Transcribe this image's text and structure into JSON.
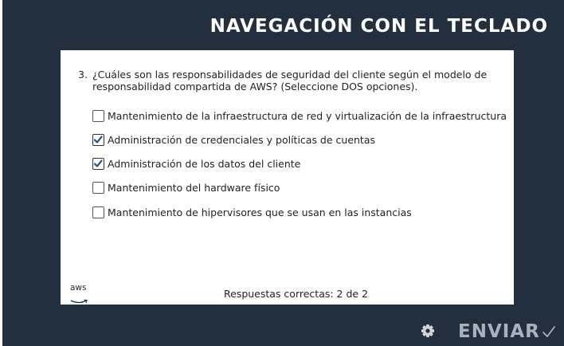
{
  "header": {
    "title": "NAVEGACIÓN CON EL TECLADO"
  },
  "question": {
    "number": "3.",
    "text": "¿Cuáles son las responsabilidades de seguridad del cliente según el modelo de responsabilidad compartida de AWS? (Seleccione DOS opciones).",
    "options": [
      {
        "label": "Mantenimiento de la infraestructura de red y virtualización de la infraestructura",
        "checked": false
      },
      {
        "label": "Administración de credenciales y políticas de cuentas",
        "checked": true
      },
      {
        "label": "Administración de los datos del cliente",
        "checked": true
      },
      {
        "label": "Mantenimiento del hardware físico",
        "checked": false
      },
      {
        "label": "Mantenimiento de hipervisores que se usan en las instancias",
        "checked": false
      }
    ]
  },
  "footer": {
    "logo": "aws",
    "score_text": "Respuestas correctas: 2 de 2"
  },
  "toolbar": {
    "settings_icon": "gear-icon",
    "submit_label": "ENVIAR",
    "submit_icon": "checkmark-icon"
  },
  "colors": {
    "background": "#232f3e",
    "card": "#ffffff",
    "submit_text": "#a9b2bc",
    "title_text": "#ffffff"
  }
}
